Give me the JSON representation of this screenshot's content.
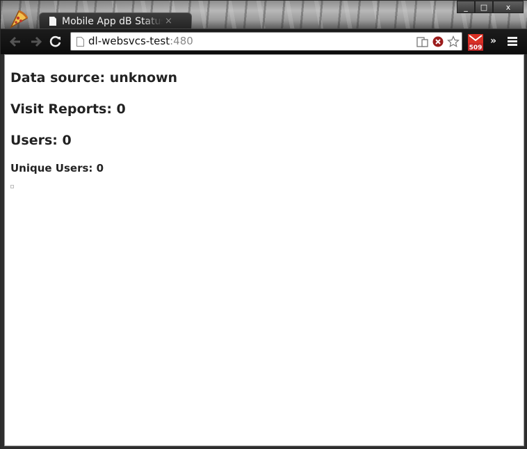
{
  "browser": {
    "tab_title": "Mobile App dB Status",
    "tab_close": "×",
    "address": {
      "host": "dl-websvcs-test",
      "port": ":480"
    },
    "extension_badge": "509",
    "overflow_label": "»"
  },
  "window_controls": {
    "minimize": "_",
    "maximize": "□",
    "close": "x"
  },
  "page": {
    "data_source": "Data source: unknown",
    "visit_reports": "Visit Reports: 0",
    "users": "Users: 0",
    "unique_users": "Unique Users: 0"
  }
}
